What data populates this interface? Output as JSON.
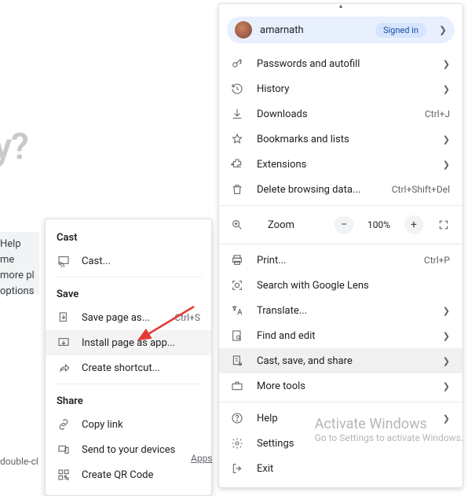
{
  "background": {
    "title_fragment": "u today?",
    "chip_lines": [
      "Help me",
      "more pl",
      "options"
    ],
    "chip2": "double-cl"
  },
  "menu": {
    "profile": {
      "name": "amarnath",
      "status": "Signed in"
    },
    "items": [
      {
        "icon": "key-icon",
        "label": "Passwords and autofill",
        "chevron": true
      },
      {
        "icon": "history-icon",
        "label": "History",
        "chevron": true
      },
      {
        "icon": "download-icon",
        "label": "Downloads",
        "shortcut": "Ctrl+J"
      },
      {
        "icon": "star-icon",
        "label": "Bookmarks and lists",
        "chevron": true
      },
      {
        "icon": "puzzle-icon",
        "label": "Extensions",
        "chevron": true
      },
      {
        "icon": "trash-icon",
        "label": "Delete browsing data...",
        "shortcut": "Ctrl+Shift+Del"
      }
    ],
    "zoom": {
      "label": "Zoom",
      "value": "100%"
    },
    "items2": [
      {
        "icon": "print-icon",
        "label": "Print...",
        "shortcut": "Ctrl+P"
      },
      {
        "icon": "lens-icon",
        "label": "Search with Google Lens"
      },
      {
        "icon": "translate-icon",
        "label": "Translate...",
        "chevron": true
      },
      {
        "icon": "find-icon",
        "label": "Find and edit",
        "chevron": true
      },
      {
        "icon": "cast-share-icon",
        "label": "Cast, save, and share",
        "chevron": true,
        "hover": true
      },
      {
        "icon": "briefcase-icon",
        "label": "More tools",
        "chevron": true
      }
    ],
    "items3": [
      {
        "icon": "help-icon",
        "label": "Help",
        "chevron": true
      },
      {
        "icon": "settings-icon",
        "label": "Settings"
      },
      {
        "icon": "exit-icon",
        "label": "Exit"
      }
    ]
  },
  "submenu": {
    "sections": [
      {
        "header": "Cast",
        "items": [
          {
            "icon": "cast-icon",
            "label": "Cast..."
          }
        ]
      },
      {
        "header": "Save",
        "items": [
          {
            "icon": "save-page-icon",
            "label": "Save page as...",
            "shortcut": "Ctrl+S"
          },
          {
            "icon": "install-app-icon",
            "label": "Install page as app...",
            "highlight": true
          },
          {
            "icon": "shortcut-icon",
            "label": "Create shortcut..."
          }
        ]
      },
      {
        "header": "Share",
        "items": [
          {
            "icon": "copy-link-icon",
            "label": "Copy link"
          },
          {
            "icon": "send-devices-icon",
            "label": "Send to your devices"
          },
          {
            "icon": "qr-icon",
            "label": "Create QR Code"
          }
        ]
      }
    ]
  },
  "watermark": {
    "line1": "Activate Windows",
    "line2": "Go to Settings to activate Windows."
  },
  "apps_link": "Apps"
}
